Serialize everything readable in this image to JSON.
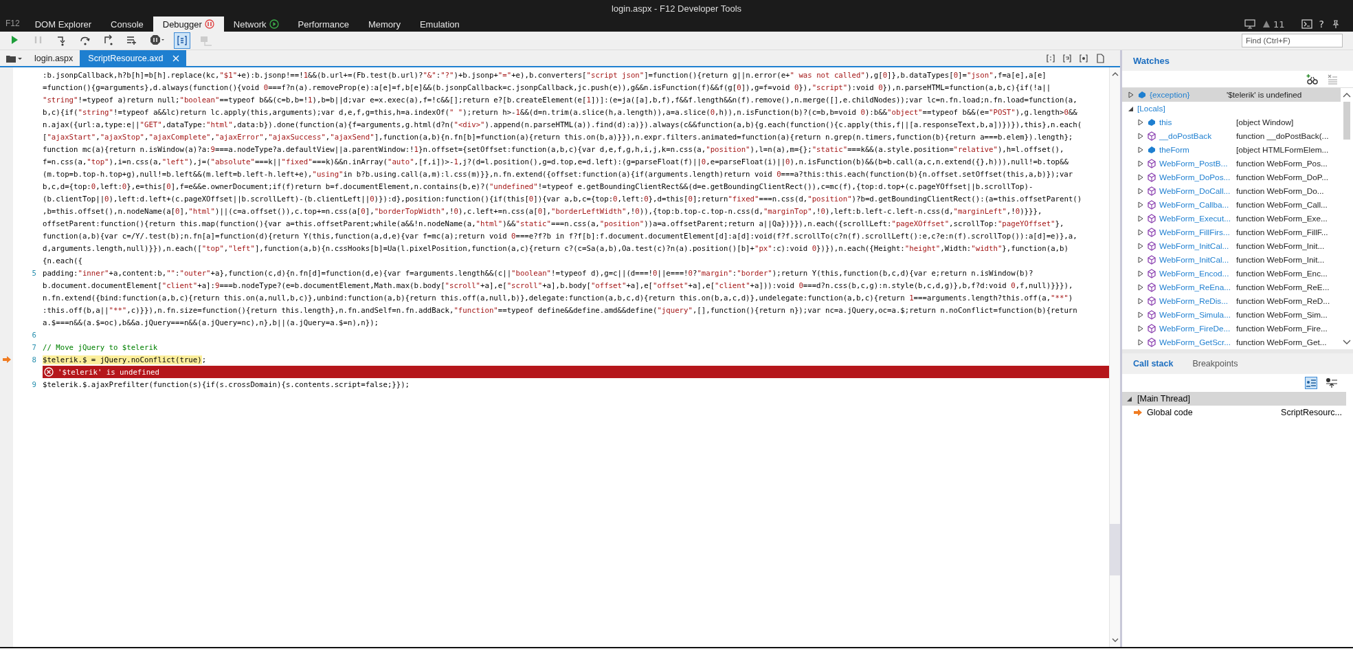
{
  "window": {
    "title": "login.aspx - F12 Developer Tools"
  },
  "tool_label": "F12",
  "tool_tabs": [
    {
      "label": "DOM Explorer",
      "selected": false,
      "paused": false,
      "recording": false
    },
    {
      "label": "Console",
      "selected": false,
      "paused": false,
      "recording": false
    },
    {
      "label": "Debugger",
      "selected": true,
      "paused": true,
      "recording": false
    },
    {
      "label": "Network",
      "selected": false,
      "paused": false,
      "recording": true
    },
    {
      "label": "Performance",
      "selected": false,
      "paused": false,
      "recording": false
    },
    {
      "label": "Memory",
      "selected": false,
      "paused": false,
      "recording": false
    },
    {
      "label": "Emulation",
      "selected": false,
      "paused": false,
      "recording": false
    }
  ],
  "notification_count": "11",
  "help": "?",
  "toolbar": {
    "buttons": [
      {
        "kind": "continue",
        "disabled": false,
        "on": false
      },
      {
        "kind": "break",
        "disabled": true,
        "on": false
      },
      {
        "kind": "step-into",
        "disabled": false,
        "on": false
      },
      {
        "kind": "step-over",
        "disabled": false,
        "on": false
      },
      {
        "kind": "step-out",
        "disabled": false,
        "on": false
      },
      {
        "kind": "break-worker",
        "disabled": false,
        "on": false
      },
      {
        "kind": "exceptions",
        "disabled": false,
        "on": false
      },
      {
        "kind": "pretty-print",
        "disabled": false,
        "on": true
      },
      {
        "kind": "just-my-code",
        "disabled": true,
        "on": false
      }
    ],
    "find": {
      "placeholder": "Find (Ctrl+F)"
    }
  },
  "documents": [
    {
      "label": "login.aspx",
      "selected": false
    },
    {
      "label": "ScriptResource.axd",
      "selected": true,
      "closable": true
    }
  ],
  "code": {
    "rows": [
      {
        "text": ":b.jsonpCallback,h?b[h]=b[h].replace(kc,\"$1\"+e):b.jsonp!==!1&&(b.url+=(Fb.test(b.url)?\"&\":\"?\")+b.jsonp+\"=\"+e),b.converters[\"script json\"]=function(){return g||n.error(e+\" was not called\"),g[0]},b.dataTypes[0]=\"json\",f=a[e],a[e]"
      },
      {
        "text": "=function(){g=arguments},d.always(function(){void 0===f?n(a).removeProp(e):a[e]=f,b[e]&&(b.jsonpCallback=c.jsonpCallback,jc.push(e)),g&&n.isFunction(f)&&f(g[0]),g=f=void 0}),\"script\"):void 0}),n.parseHTML=function(a,b,c){if(!a||"
      },
      {
        "text": "\"string\"!=typeof a)return null;\"boolean\"==typeof b&&(c=b,b=!1),b=b||d;var e=x.exec(a),f=!c&&[];return e?[b.createElement(e[1])]:(e=ja([a],b,f),f&&f.length&&n(f).remove(),n.merge([],e.childNodes));var lc=n.fn.load;n.fn.load=function(a,"
      },
      {
        "text": "b,c){if(\"string\"!=typeof a&&lc)return lc.apply(this,arguments);var d,e,f,g=this,h=a.indexOf(\" \");return h>-1&&(d=n.trim(a.slice(h,a.length)),a=a.slice(0,h)),n.isFunction(b)?(c=b,b=void 0):b&&\"object\"==typeof b&&(e=\"POST\"),g.length>0&&"
      },
      {
        "text": "n.ajax({url:a,type:e||\"GET\",dataType:\"html\",data:b}).done(function(a){f=arguments,g.html(d?n(\"<div>\").append(n.parseHTML(a)).find(d):a)}).always(c&&function(a,b){g.each(function(){c.apply(this,f||[a.responseText,b,a])})}),this},n.each("
      },
      {
        "text": "[\"ajaxStart\",\"ajaxStop\",\"ajaxComplete\",\"ajaxError\",\"ajaxSuccess\",\"ajaxSend\"],function(a,b){n.fn[b]=function(a){return this.on(b,a)}}),n.expr.filters.animated=function(a){return n.grep(n.timers,function(b){return a===b.elem}).length};"
      },
      {
        "text": "function mc(a){return n.isWindow(a)?a:9===a.nodeType?a.defaultView||a.parentWindow:!1}n.offset={setOffset:function(a,b,c){var d,e,f,g,h,i,j,k=n.css(a,\"position\"),l=n(a),m={};\"static\"===k&&(a.style.position=\"relative\"),h=l.offset(),"
      },
      {
        "text": "f=n.css(a,\"top\"),i=n.css(a,\"left\"),j=(\"absolute\"===k||\"fixed\"===k)&&n.inArray(\"auto\",[f,i])>-1,j?(d=l.position(),g=d.top,e=d.left):(g=parseFloat(f)||0,e=parseFloat(i)||0),n.isFunction(b)&&(b=b.call(a,c,n.extend({},h))),null!=b.top&&"
      },
      {
        "text": "(m.top=b.top-h.top+g),null!=b.left&&(m.left=b.left-h.left+e),\"using\"in b?b.using.call(a,m):l.css(m)}},n.fn.extend({offset:function(a){if(arguments.length)return void 0===a?this:this.each(function(b){n.offset.setOffset(this,a,b)});var"
      },
      {
        "text": "b,c,d={top:0,left:0},e=this[0],f=e&&e.ownerDocument;if(f)return b=f.documentElement,n.contains(b,e)?(\"undefined\"!=typeof e.getBoundingClientRect&&(d=e.getBoundingClientRect()),c=mc(f),{top:d.top+(c.pageYOffset||b.scrollTop)-"
      },
      {
        "text": "(b.clientTop||0),left:d.left+(c.pageXOffset||b.scrollLeft)-(b.clientLeft||0)}):d},position:function(){if(this[0]){var a,b,c={top:0,left:0},d=this[0];return\"fixed\"===n.css(d,\"position\")?b=d.getBoundingClientRect():(a=this.offsetParent()"
      },
      {
        "text": ",b=this.offset(),n.nodeName(a[0],\"html\")||(c=a.offset()),c.top+=n.css(a[0],\"borderTopWidth\",!0),c.left+=n.css(a[0],\"borderLeftWidth\",!0)),{top:b.top-c.top-n.css(d,\"marginTop\",!0),left:b.left-c.left-n.css(d,\"marginLeft\",!0)}}},"
      },
      {
        "text": "offsetParent:function(){return this.map(function(){var a=this.offsetParent;while(a&&!n.nodeName(a,\"html\")&&\"static\"===n.css(a,\"position\"))a=a.offsetParent;return a||Qa})}}),n.each({scrollLeft:\"pageXOffset\",scrollTop:\"pageYOffset\"},"
      },
      {
        "text": "function(a,b){var c=/Y/.test(b);n.fn[a]=function(d){return Y(this,function(a,d,e){var f=mc(a);return void 0===e?f?b in f?f[b]:f.document.documentElement[d]:a[d]:void(f?f.scrollTo(c?n(f).scrollLeft():e,c?e:n(f).scrollTop()):a[d]=e)},a,"
      },
      {
        "text": "d,arguments.length,null)}}),n.each([\"top\",\"left\"],function(a,b){n.cssHooks[b]=Ua(l.pixelPosition,function(a,c){return c?(c=Sa(a,b),Oa.test(c)?n(a).position()[b]+\"px\":c):void 0})}),n.each({Height:\"height\",Width:\"width\"},function(a,b)"
      },
      {
        "text": "{n.each({"
      },
      {
        "number": "5",
        "text": "padding:\"inner\"+a,content:b,\"\":\"outer\"+a},function(c,d){n.fn[d]=function(d,e){var f=arguments.length&&(c||\"boolean\"!=typeof d),g=c||(d===!0||e===!0?\"margin\":\"border\");return Y(this,function(b,c,d){var e;return n.isWindow(b)?"
      },
      {
        "text": "b.document.documentElement[\"client\"+a]:9===b.nodeType?(e=b.documentElement,Math.max(b.body[\"scroll\"+a],e[\"scroll\"+a],b.body[\"offset\"+a],e[\"offset\"+a],e[\"client\"+a])):void 0===d?n.css(b,c,g):n.style(b,c,d,g)},b,f?d:void 0,f,null)}}}),"
      },
      {
        "text": "n.fn.extend({bind:function(a,b,c){return this.on(a,null,b,c)},unbind:function(a,b){return this.off(a,null,b)},delegate:function(a,b,c,d){return this.on(b,a,c,d)},undelegate:function(a,b,c){return 1===arguments.length?this.off(a,\"**\")"
      },
      {
        "text": ":this.off(b,a||\"**\",c)}}),n.fn.size=function(){return this.length},n.fn.andSelf=n.fn.addBack,\"function\"==typeof define&&define.amd&&define(\"jquery\",[],function(){return n});var nc=a.jQuery,oc=a.$;return n.noConflict=function(b){return"
      },
      {
        "text": "a.$===n&&(a.$=oc),b&&a.jQuery===n&&(a.jQuery=nc),n},b||(a.jQuery=a.$=n),n});"
      },
      {
        "number": "6",
        "text": ""
      },
      {
        "number": "7",
        "text": "// Move jQuery to $telerik"
      },
      {
        "number": "8",
        "current": true,
        "highlighted": "$telerik.$ = jQuery.noConflict(true)",
        "text": ";"
      },
      {
        "kind": "error",
        "text": "'$telerik' is undefined"
      },
      {
        "number": "9",
        "text": "$telerik.$.ajaxPrefilter(function(s){if(s.crossDomain){s.contents.script=false;}});"
      }
    ]
  },
  "watches": {
    "title": "Watches",
    "rows": [
      {
        "kind": "object",
        "name": "{exception}",
        "value": "'$telerik' is undefined",
        "selected": true,
        "expanded": false
      },
      {
        "kind": "scope",
        "name": "[Locals]",
        "selected": false,
        "expanded": true,
        "children": [
          {
            "kind": "object",
            "name": "this",
            "value": "[object Window]",
            "expanded": false
          },
          {
            "kind": "function",
            "name": "__doPostBack",
            "value": "function __doPostBack(...",
            "expanded": false
          },
          {
            "kind": "object",
            "name": "theForm",
            "value": "[object HTMLFormElem...",
            "expanded": false
          },
          {
            "kind": "function",
            "name": "WebForm_PostB...",
            "value": "function WebForm_Pos...",
            "expanded": false
          },
          {
            "kind": "function",
            "name": "WebForm_DoPos...",
            "value": "function WebForm_DoP...",
            "expanded": false
          },
          {
            "kind": "function",
            "name": "WebForm_DoCall...",
            "value": "function WebForm_Do...",
            "expanded": false
          },
          {
            "kind": "function",
            "name": "WebForm_Callba...",
            "value": "function WebForm_Call...",
            "expanded": false
          },
          {
            "kind": "function",
            "name": "WebForm_Execut...",
            "value": "function WebForm_Exe...",
            "expanded": false
          },
          {
            "kind": "function",
            "name": "WebForm_FillFirs...",
            "value": "function WebForm_FillF...",
            "expanded": false
          },
          {
            "kind": "function",
            "name": "WebForm_InitCal...",
            "value": "function WebForm_Init...",
            "expanded": false
          },
          {
            "kind": "function",
            "name": "WebForm_InitCal...",
            "value": "function WebForm_Init...",
            "expanded": false
          },
          {
            "kind": "function",
            "name": "WebForm_Encod...",
            "value": "function WebForm_Enc...",
            "expanded": false
          },
          {
            "kind": "function",
            "name": "WebForm_ReEna...",
            "value": "function WebForm_ReE...",
            "expanded": false
          },
          {
            "kind": "function",
            "name": "WebForm_ReDis...",
            "value": "function WebForm_ReD...",
            "expanded": false
          },
          {
            "kind": "function",
            "name": "WebForm_Simula...",
            "value": "function WebForm_Sim...",
            "expanded": false
          },
          {
            "kind": "function",
            "name": "WebForm_FireDe...",
            "value": "function WebForm_Fire...",
            "expanded": false
          },
          {
            "kind": "function",
            "name": "WebForm_GetScr...",
            "value": "function WebForm_Get...",
            "expanded": false
          }
        ]
      }
    ]
  },
  "call_stack": {
    "tabs": [
      {
        "label": "Call stack",
        "selected": true
      },
      {
        "label": "Breakpoints",
        "selected": false
      }
    ],
    "threads": [
      {
        "label": "[Main Thread]",
        "expanded": true,
        "selected": true,
        "frames": [
          {
            "label": "Global code",
            "location": "ScriptResourc...",
            "current": true
          }
        ]
      }
    ]
  }
}
